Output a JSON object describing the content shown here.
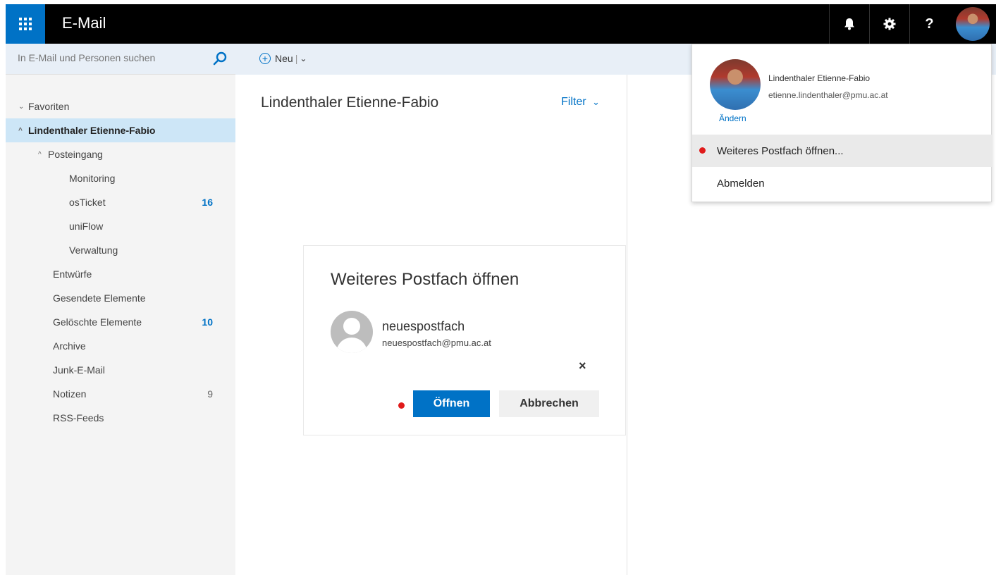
{
  "header": {
    "app_title": "E-Mail",
    "help_label": "?",
    "icons": [
      "app-launcher-icon",
      "bell-icon",
      "gear-icon",
      "help-icon"
    ]
  },
  "search": {
    "placeholder": "In E-Mail und Personen suchen"
  },
  "folders": [
    {
      "label": "Favoriten",
      "chevron": "⌄",
      "count": ""
    },
    {
      "label": "Lindenthaler Etienne-Fabio",
      "chevron": "^",
      "count": ""
    },
    {
      "label": "Posteingang",
      "chevron": "^",
      "count": ""
    },
    {
      "label": "Monitoring",
      "chevron": "",
      "count": ""
    },
    {
      "label": "osTicket",
      "chevron": "",
      "count": "16"
    },
    {
      "label": "uniFlow",
      "chevron": "",
      "count": ""
    },
    {
      "label": "Verwaltung",
      "chevron": "",
      "count": ""
    },
    {
      "label": "Entwürfe",
      "chevron": "",
      "count": ""
    },
    {
      "label": "Gesendete Elemente",
      "chevron": "",
      "count": ""
    },
    {
      "label": "Gelöschte Elemente",
      "chevron": "",
      "count": "10"
    },
    {
      "label": "Archive",
      "chevron": "",
      "count": ""
    },
    {
      "label": "Junk-E-Mail",
      "chevron": "",
      "count": ""
    },
    {
      "label": "Notizen",
      "chevron": "",
      "count": "9"
    },
    {
      "label": "RSS-Feeds",
      "chevron": "",
      "count": ""
    }
  ],
  "toolbar": {
    "new_label": "Neu",
    "separator": "|",
    "dropdown_glyph": "⌄"
  },
  "message_list": {
    "title": "Lindenthaler Etienne-Fabio",
    "filter_label": "Filter",
    "filter_glyph": "⌄"
  },
  "dialog": {
    "title": "Weiteres Postfach öffnen",
    "mailbox_name": "neuespostfach",
    "mailbox_email": "neuespostfach@pmu.ac.at",
    "close_glyph": "×",
    "open_label": "Öffnen",
    "cancel_label": "Abbrechen"
  },
  "account_menu": {
    "name": "Lindenthaler Etienne-Fabio",
    "email": "etienne.lindenthaler@pmu.ac.at",
    "change_label": "Ändern",
    "open_mailbox_label": "Weiteres Postfach öffnen...",
    "logout_label": "Abmelden"
  },
  "colors": {
    "accent": "#0072c6",
    "topbar": "#000000",
    "annotation_dot": "#e01b1b",
    "selected_folder": "#cde6f7"
  }
}
